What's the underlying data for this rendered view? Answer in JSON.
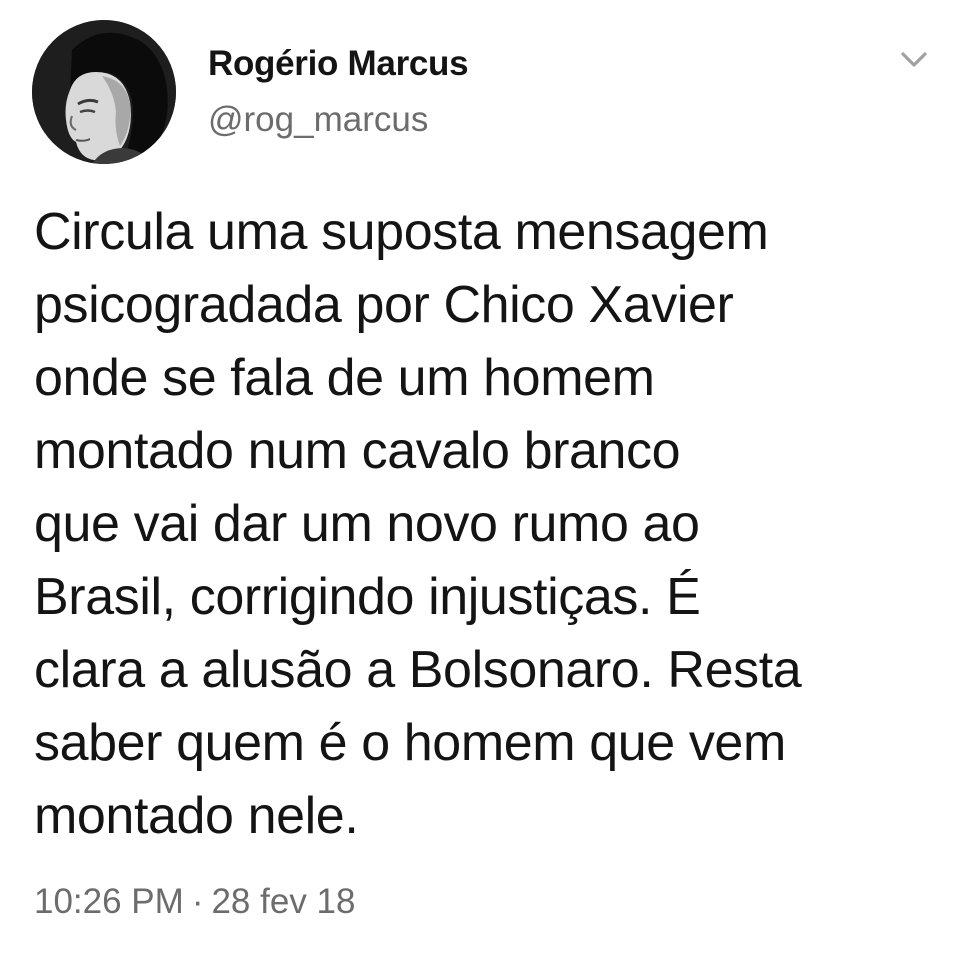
{
  "tweet": {
    "author": {
      "display_name": "Rogério Marcus",
      "handle": "@rog_marcus",
      "avatar_icon": "user-avatar-photo"
    },
    "menu_icon": "chevron-down-icon",
    "text": "Circula uma suposta mensagem\npsicogradada por Chico Xavier\nonde se fala de um homem\nmontado num cavalo branco\nque vai dar um novo rumo ao\nBrasil, corrigindo injustiças. É\nclara a alusão a Bolsonaro. Resta\nsaber quem é o homem que vem\nmontado nele.",
    "time": "10:26 PM",
    "separator": "·",
    "date": "28 fev 18"
  },
  "colors": {
    "text": "#141414",
    "secondary_text": "#6c6c6c",
    "background": "#ffffff"
  }
}
